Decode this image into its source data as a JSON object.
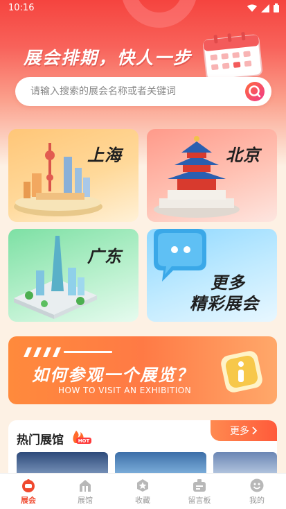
{
  "status_bar": {
    "time": "10:16"
  },
  "hero": {
    "slogan": "展会排期，快人一步"
  },
  "search": {
    "placeholder": "请输入搜索的展会名称或者关键词"
  },
  "cities": [
    {
      "label": "上海"
    },
    {
      "label": "北京"
    },
    {
      "label": "广东"
    },
    {
      "label": "更多\n精彩展会"
    }
  ],
  "more_card": {
    "line1": "更多",
    "line2": "精彩展会"
  },
  "banner": {
    "title": "如何参观一个展览？",
    "subtitle": "HOW TO VISIT AN EXHIBITION"
  },
  "hot": {
    "title": "热门展馆",
    "badge": "HOT",
    "more_label": "更多"
  },
  "tabs": [
    {
      "label": "展会",
      "icon": "expo-icon",
      "active": true
    },
    {
      "label": "展馆",
      "icon": "building-icon",
      "active": false
    },
    {
      "label": "收藏",
      "icon": "star-icon",
      "active": false
    },
    {
      "label": "留言板",
      "icon": "message-board-icon",
      "active": false
    },
    {
      "label": "我的",
      "icon": "profile-icon",
      "active": false
    }
  ],
  "colors": {
    "brand_red": "#f5443f",
    "active_tab": "#f0492f",
    "inactive_tab": "#999999"
  }
}
